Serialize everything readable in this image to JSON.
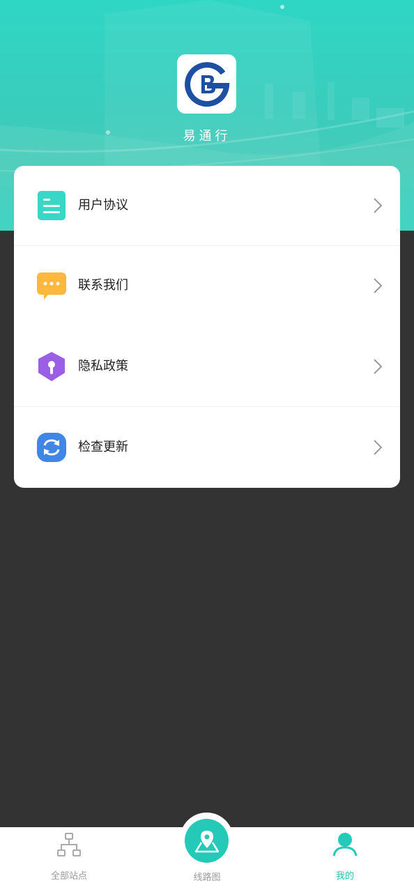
{
  "header": {
    "app_name": "易通行",
    "logo_icon": "beijing-subway-logo-icon"
  },
  "menu": {
    "items": [
      {
        "label": "用户协议",
        "icon": "document-icon",
        "color": "#39d7c5"
      },
      {
        "label": "联系我们",
        "icon": "chat-bubble-icon",
        "color": "#ffb83d"
      },
      {
        "label": "隐私政策",
        "icon": "shield-lock-icon",
        "color": "#9a5fe6"
      },
      {
        "label": "检查更新",
        "icon": "refresh-icon",
        "color": "#3f86e6"
      }
    ]
  },
  "tabbar": {
    "tabs": [
      {
        "label": "全部站点",
        "icon": "network-icon",
        "active": false
      },
      {
        "label": "线路图",
        "icon": "map-pin-icon",
        "active": false
      },
      {
        "label": "我的",
        "icon": "user-icon",
        "active": true
      }
    ]
  },
  "colors": {
    "accent": "#25c9b7",
    "background": "#333333",
    "card": "#ffffff",
    "logo_blue": "#1d4fa3"
  }
}
